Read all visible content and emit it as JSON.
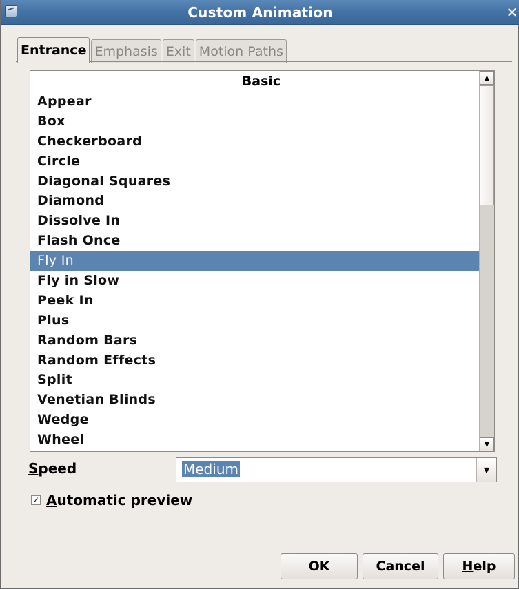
{
  "window": {
    "title": "Custom Animation",
    "close_glyph": "✕",
    "icon": "app-icon"
  },
  "tabs": [
    {
      "label": "Entrance",
      "active": true
    },
    {
      "label": "Emphasis",
      "active": false
    },
    {
      "label": "Exit",
      "active": false
    },
    {
      "label": "Motion Paths",
      "active": false
    }
  ],
  "effects": {
    "header": "Basic",
    "items": [
      "Appear",
      "Box",
      "Checkerboard",
      "Circle",
      "Diagonal Squares",
      "Diamond",
      "Dissolve In",
      "Flash Once",
      "Fly In",
      "Fly in Slow",
      "Peek In",
      "Plus",
      "Random Bars",
      "Random Effects",
      "Split",
      "Venetian Blinds",
      "Wedge",
      "Wheel"
    ],
    "selected": "Fly In"
  },
  "speed": {
    "label_mnemonic": "S",
    "label_rest": "peed",
    "value": "Medium"
  },
  "preview": {
    "checked": true,
    "label_mnemonic": "A",
    "label_rest": "utomatic preview"
  },
  "buttons": {
    "ok": "OK",
    "cancel": "Cancel",
    "help_mnemonic": "H",
    "help_rest": "elp"
  },
  "colors": {
    "titlebar": "#4674a6",
    "selection": "#5b84b0",
    "dialog_bg": "#efebe7"
  }
}
